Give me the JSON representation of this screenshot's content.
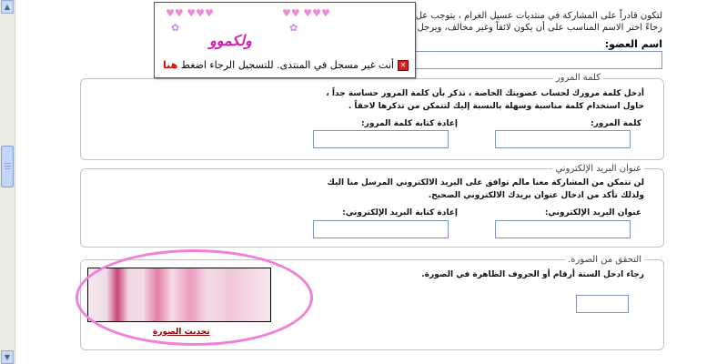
{
  "intro": {
    "line1": "لتكون قادراً على المشاركة في منتديات عسيل الغرام ، يتوجب عل",
    "line2": "رجاءً اختر الاسم المناسب على أن يكون لائقاً وغير مخالف، ويرجل"
  },
  "username": {
    "label": "اسم العضو:",
    "value": ""
  },
  "password_section": {
    "legend": "كلمة المرور",
    "description": "أدخل كلمة مرورك لحساب عضويتك الخاصة ، تذكر بأن كلمة المرور حساسة جداً ، حاول استخدام كلمة مناسبة وسهلة بالنسبة إليك لتتمكن من تذكرها لاحقاً .",
    "password_label": "كلمة المرور:",
    "confirm_label": "إعادة كتابة كلمة المرور:"
  },
  "email_section": {
    "legend": "عنوان البريد الإلكتروني",
    "description": "لن تتمكن من المشاركة معنا مالم توافق على البريد الالكتروني المرسل منا اليك ولذلك تأكد من ادخال عنوان بريدك الالكتروني الصحيح.",
    "email_label": "عنوان البريد الإلكتروني:",
    "confirm_label": "إعادة كتابة البريد الإلكتروني:"
  },
  "captcha_section": {
    "legend": "التحقق من الصورة.",
    "description": "رجاء ادخل الستة أرقام أو الحروف الظاهرة في الصورة.",
    "refresh_label": "تحديث الصورة",
    "value": ""
  },
  "notice": {
    "welcome": "ولكموو",
    "message": "أنت غير مسجل في المنتدى. للتسجيل الرجاء اضغط",
    "link": "هنا",
    "hearts": "♥♥ ♥♥♥"
  },
  "colors": {
    "marker": "#f27fd8",
    "link": "#d90000",
    "welcome": "#d21fb3"
  }
}
